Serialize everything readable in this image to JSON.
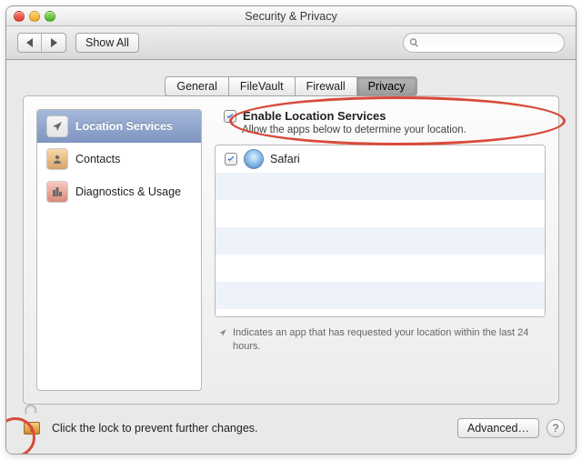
{
  "window": {
    "title": "Security & Privacy"
  },
  "toolbar": {
    "show_all": "Show All",
    "search_placeholder": ""
  },
  "tabs": {
    "general": {
      "label": "General"
    },
    "filevault": {
      "label": "FileVault"
    },
    "firewall": {
      "label": "Firewall"
    },
    "privacy": {
      "label": "Privacy"
    }
  },
  "sidebar": {
    "location": {
      "label": "Location Services"
    },
    "contacts": {
      "label": "Contacts"
    },
    "diagnostics": {
      "label": "Diagnostics & Usage"
    }
  },
  "enable": {
    "checkbox_label": "Enable Location Services",
    "desc": "Allow the apps below to determine your location."
  },
  "apps": {
    "items": [
      {
        "label": "Safari",
        "checked": true
      }
    ]
  },
  "footnote": {
    "text": "Indicates an app that has requested your location within the last 24 hours."
  },
  "bottom": {
    "lock_text": "Click the lock to prevent further changes.",
    "advanced_label": "Advanced…"
  }
}
